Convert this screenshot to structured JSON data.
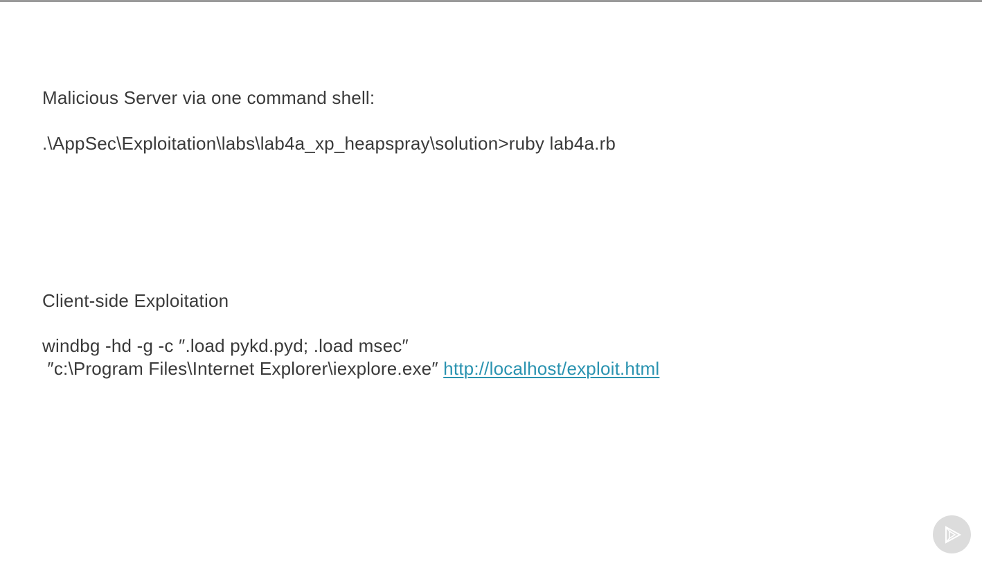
{
  "slide": {
    "heading_1": "Malicious Server via one command shell:",
    "command_1": ".\\AppSec\\Exploitation\\labs\\lab4a_xp_heapspray\\solution>ruby lab4a.rb",
    "heading_2": "Client-side Exploitation",
    "command_2_line_1": "windbg -hd -g -c ″.load pykd.pyd; .load msec″",
    "command_2_line_2": " ″c:\\Program Files\\Internet Explorer\\iexplore.exe″ ",
    "link_text": "http://localhost/exploit.html"
  },
  "player": {
    "icon": "play-logo-icon"
  },
  "colors": {
    "text": "#3a3a3a",
    "link": "#2a93b0",
    "top_bar": "#9a9a9a",
    "play_button_bg": "#dcdcdc"
  }
}
